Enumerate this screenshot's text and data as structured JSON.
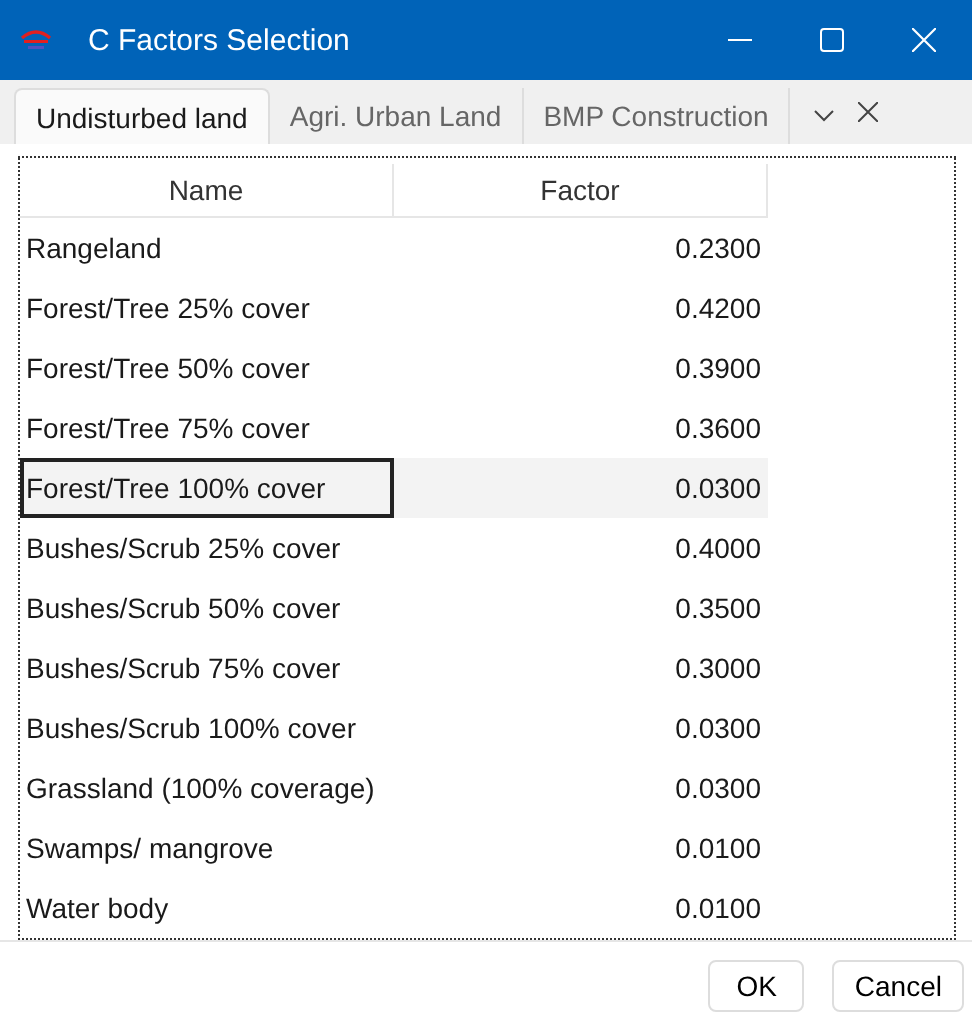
{
  "window": {
    "title": "C Factors Selection"
  },
  "tabs": [
    {
      "label": "Undisturbed land",
      "selected": true
    },
    {
      "label": "Agri. Urban Land",
      "selected": false
    },
    {
      "label": "BMP Construction",
      "selected": false
    }
  ],
  "table": {
    "columns": [
      "Name",
      "Factor"
    ],
    "rows": [
      {
        "name": "Rangeland",
        "factor": "0.2300",
        "selected": false
      },
      {
        "name": "Forest/Tree 25% cover",
        "factor": "0.4200",
        "selected": false
      },
      {
        "name": "Forest/Tree 50% cover",
        "factor": "0.3900",
        "selected": false
      },
      {
        "name": "Forest/Tree 75% cover",
        "factor": "0.3600",
        "selected": false
      },
      {
        "name": "Forest/Tree 100% cover",
        "factor": "0.0300",
        "selected": true
      },
      {
        "name": "Bushes/Scrub 25% cover",
        "factor": "0.4000",
        "selected": false
      },
      {
        "name": "Bushes/Scrub 50% cover",
        "factor": "0.3500",
        "selected": false
      },
      {
        "name": "Bushes/Scrub 75% cover",
        "factor": "0.3000",
        "selected": false
      },
      {
        "name": "Bushes/Scrub 100% cover",
        "factor": "0.0300",
        "selected": false
      },
      {
        "name": "Grassland (100% coverage)",
        "factor": "0.0300",
        "selected": false
      },
      {
        "name": "Swamps/ mangrove",
        "factor": "0.0100",
        "selected": false
      },
      {
        "name": "Water body",
        "factor": "0.0100",
        "selected": false
      }
    ]
  },
  "buttons": [
    "OK",
    "Cancel"
  ]
}
